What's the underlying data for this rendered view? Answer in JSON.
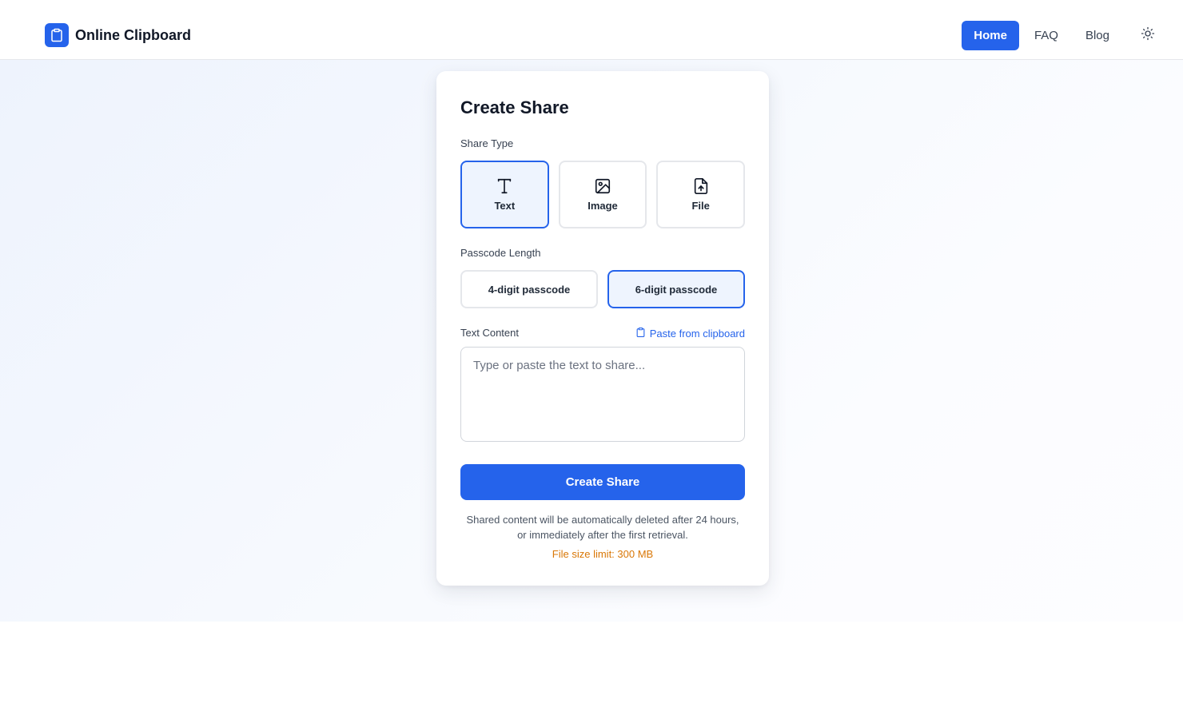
{
  "header": {
    "brand_name": "Online Clipboard",
    "nav": [
      {
        "label": "Home",
        "active": true
      },
      {
        "label": "FAQ",
        "active": false
      },
      {
        "label": "Blog",
        "active": false
      }
    ],
    "theme_icon": "sun-icon"
  },
  "card": {
    "title": "Create Share",
    "share_type": {
      "label": "Share Type",
      "options": [
        {
          "label": "Text",
          "icon": "text-type-icon",
          "selected": true
        },
        {
          "label": "Image",
          "icon": "image-icon",
          "selected": false
        },
        {
          "label": "File",
          "icon": "file-upload-icon",
          "selected": false
        }
      ]
    },
    "passcode": {
      "label": "Passcode Length",
      "options": [
        {
          "label": "4-digit passcode",
          "selected": false
        },
        {
          "label": "6-digit passcode",
          "selected": true
        }
      ]
    },
    "text_content": {
      "label": "Text Content",
      "paste_label": "Paste from clipboard",
      "placeholder": "Type or paste the text to share...",
      "value": ""
    },
    "submit_label": "Create Share",
    "note": "Shared content will be automatically deleted after 24 hours, or immediately after the first retrieval.",
    "limit": "File size limit: 300 MB"
  },
  "colors": {
    "accent": "#2563eb",
    "selected_bg": "#eef4fe",
    "warning": "#d97706"
  }
}
